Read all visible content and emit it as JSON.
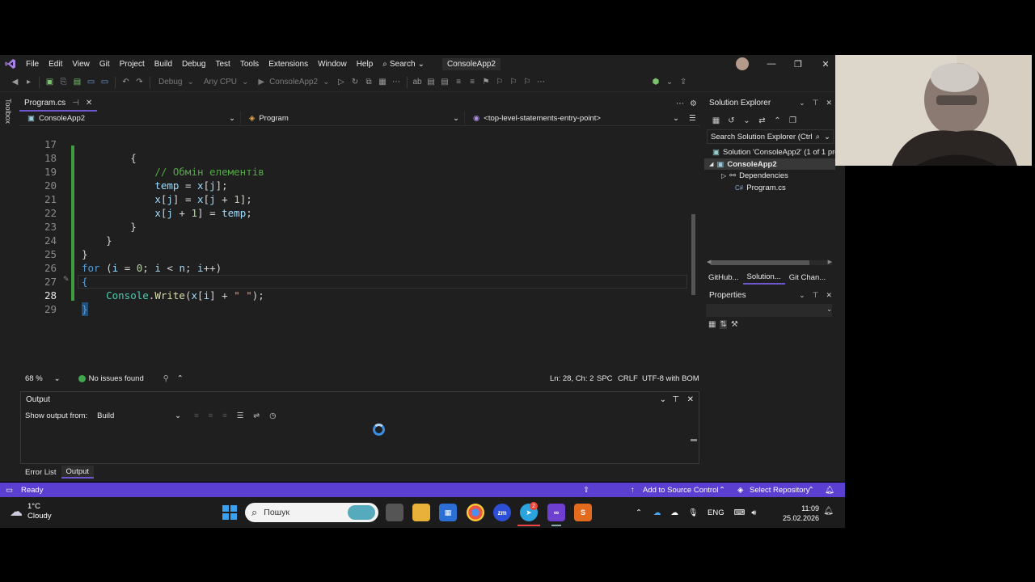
{
  "menu": {
    "items": [
      "File",
      "Edit",
      "View",
      "Git",
      "Project",
      "Build",
      "Debug",
      "Test",
      "Tools",
      "Extensions",
      "Window",
      "Help"
    ],
    "search_label": "Search",
    "project_title": "ConsoleApp2"
  },
  "toolbar": {
    "config": "Debug",
    "platform": "Any CPU",
    "start_target": "ConsoleApp2"
  },
  "toolbox": {
    "label": "Toolbox"
  },
  "document_tab": {
    "label": "Program.cs"
  },
  "navbar": {
    "project": "ConsoleApp2",
    "type": "Program",
    "member": "<top-level-statements-entry-point>"
  },
  "editor": {
    "lines": [
      {
        "n": "17",
        "text": "        {"
      },
      {
        "n": "18",
        "text": "            // Обмін елементів"
      },
      {
        "n": "19",
        "text": "            temp = x[j];"
      },
      {
        "n": "20",
        "text": "            x[j] = x[j + 1];"
      },
      {
        "n": "21",
        "text": "            x[j + 1] = temp;"
      },
      {
        "n": "22",
        "text": "        }"
      },
      {
        "n": "23",
        "text": "    }"
      },
      {
        "n": "24",
        "text": "}"
      },
      {
        "n": "25",
        "text": "for (i = 0; i < n; i++)"
      },
      {
        "n": "26",
        "text": "{"
      },
      {
        "n": "27",
        "text": "    Console.Write(x[i] + \" \");"
      },
      {
        "n": "28",
        "text": "}"
      },
      {
        "n": "29",
        "text": ""
      }
    ],
    "current_line": "28"
  },
  "editor_status": {
    "zoom": "68 %",
    "issues": "No issues found",
    "position": "Ln: 28, Ch: 2",
    "whitespace": "SPC",
    "line_endings": "CRLF",
    "encoding": "UTF-8 with BOM"
  },
  "output": {
    "title": "Output",
    "show_from_label": "Show output from:",
    "source": "Build"
  },
  "bottom_tabs": [
    "Error List",
    "Output"
  ],
  "solution_explorer": {
    "title": "Solution Explorer",
    "search_placeholder": "Search Solution Explorer (Ctrl",
    "solution": "Solution 'ConsoleApp2' (1 of 1 pro",
    "project": "ConsoleApp2",
    "dependencies": "Dependencies",
    "file": "Program.cs",
    "file_badge": "C#",
    "tabs": [
      "GitHub...",
      "Solution...",
      "Git Chan..."
    ]
  },
  "properties": {
    "title": "Properties"
  },
  "statusbar": {
    "ready": "Ready",
    "add_source_control": "Add to Source Control",
    "select_repository": "Select Repository"
  },
  "taskbar": {
    "temperature": "1°C",
    "condition": "Cloudy",
    "search_placeholder": "Пошук",
    "language": "ENG",
    "time": "11:09",
    "date": "25.02.2026",
    "telegram_badge": "2"
  },
  "colors": {
    "accent": "#5b3fd1",
    "background": "#1f1f1f",
    "comment": "#57a64a",
    "keyword": "#569cd6",
    "variable": "#9cdcfe",
    "type": "#4ec9b0",
    "method": "#dcdcaa",
    "string": "#d69d85",
    "number": "#b5cea8"
  }
}
